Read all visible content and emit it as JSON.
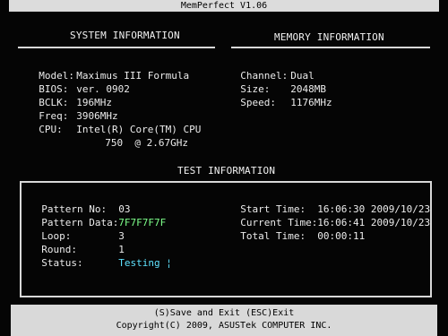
{
  "title": "MemPerfect V1.06",
  "system": {
    "heading": "SYSTEM INFORMATION",
    "rows": [
      {
        "label": "Model:",
        "value": "Maximus III Formula"
      },
      {
        "label": "BIOS:",
        "value": "ver. 0902"
      },
      {
        "label": "BCLK:",
        "value": "196MHz"
      },
      {
        "label": "Freq:",
        "value": "3906MHz"
      },
      {
        "label": "CPU:",
        "value": "Intel(R) Core(TM) CPU"
      },
      {
        "label": "",
        "value": "750  @ 2.67GHz"
      }
    ]
  },
  "memory": {
    "heading": "MEMORY INFORMATION",
    "rows": [
      {
        "label": "Channel:",
        "value": "Dual"
      },
      {
        "label": "Size:",
        "value": "2048MB"
      },
      {
        "label": "Speed:",
        "value": "1176MHz"
      }
    ]
  },
  "test": {
    "heading": "TEST INFORMATION",
    "left": [
      {
        "label": "Pattern No:",
        "value": "03"
      },
      {
        "label": "Pattern Data:",
        "value": "7F7F7F7F"
      },
      {
        "label": "Loop:",
        "value": "3"
      },
      {
        "label": "Round:",
        "value": "1"
      },
      {
        "label": "Status:",
        "value": "Testing ¦"
      }
    ],
    "right": [
      {
        "label": "Start Time:",
        "value": "16:06:30 2009/10/23"
      },
      {
        "label": "Current Time:",
        "value": "16:06:41 2009/10/23"
      },
      {
        "label": "Total Time:",
        "value": "00:00:11"
      }
    ]
  },
  "footer": {
    "keys": "(S)Save and Exit  (ESC)Exit",
    "copyright": "Copyright(C) 2009, ASUSTek COMPUTER INC."
  },
  "colors": {
    "background": "#050505",
    "text": "#ececec",
    "highlight_green": "#7dff8a",
    "highlight_cyan": "#5fe3ff",
    "bar": "#d9d9d9"
  }
}
